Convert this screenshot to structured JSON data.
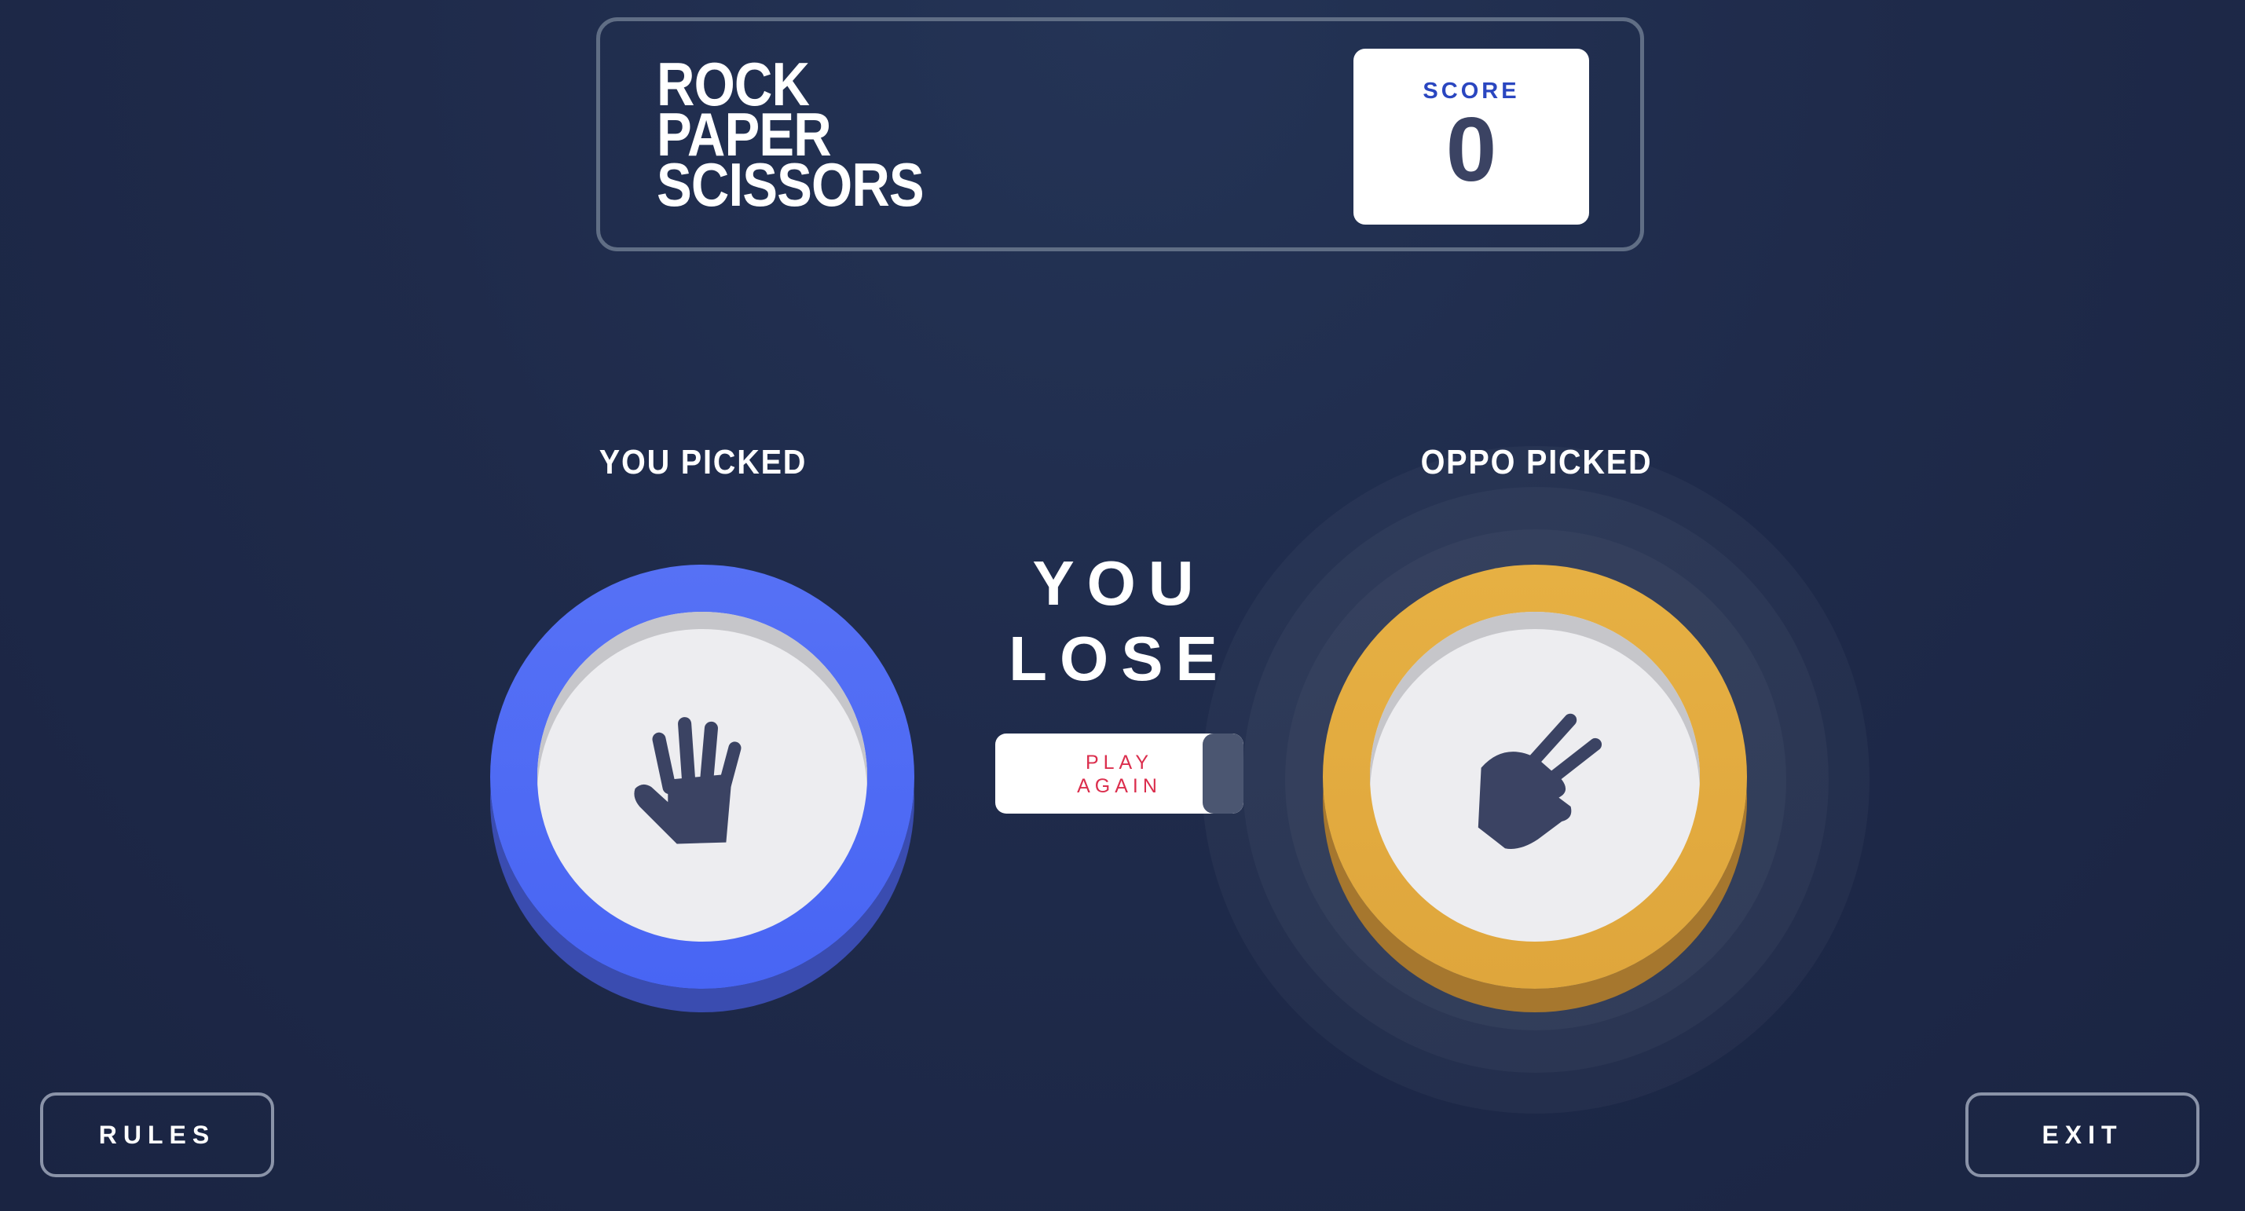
{
  "header": {
    "title_lines": [
      "ROCK",
      "PAPER",
      "SCISSORS"
    ],
    "score_label": "SCORE",
    "score_value": "0"
  },
  "player": {
    "label": "YOU PICKED",
    "pick": "paper",
    "icon": "paper-hand-icon",
    "color": "#4865f4"
  },
  "opponent": {
    "label": "OPPO PICKED",
    "pick": "scissors",
    "icon": "scissors-hand-icon",
    "color": "#dfa63c"
  },
  "result": {
    "lines": [
      "YOU",
      "LOSE"
    ],
    "play_again_lines": [
      "PLAY",
      "AGAIN"
    ],
    "play_again_color": "#db2e4d"
  },
  "buttons": {
    "rules": "RULES",
    "exit": "EXIT"
  },
  "colors": {
    "background": "#1f2b4b",
    "header_border": "#606e85",
    "score_label": "#2a46c0",
    "score_value": "#3b4363",
    "icon": "#3b4363"
  }
}
